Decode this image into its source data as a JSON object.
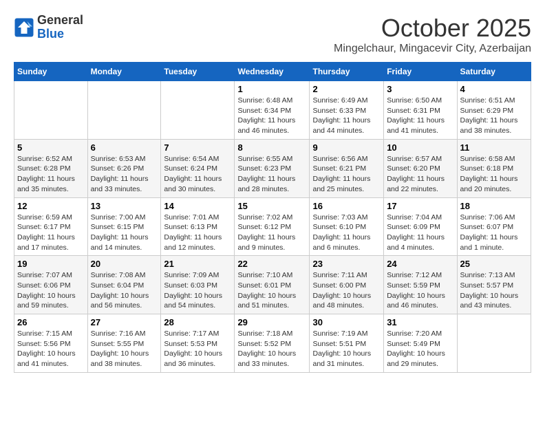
{
  "header": {
    "logo_line1": "General",
    "logo_line2": "Blue",
    "month": "October 2025",
    "location": "Mingelchaur, Mingacevir City, Azerbaijan"
  },
  "columns": [
    "Sunday",
    "Monday",
    "Tuesday",
    "Wednesday",
    "Thursday",
    "Friday",
    "Saturday"
  ],
  "weeks": [
    [
      {
        "day": "",
        "info": ""
      },
      {
        "day": "",
        "info": ""
      },
      {
        "day": "",
        "info": ""
      },
      {
        "day": "1",
        "info": "Sunrise: 6:48 AM\nSunset: 6:34 PM\nDaylight: 11 hours\nand 46 minutes."
      },
      {
        "day": "2",
        "info": "Sunrise: 6:49 AM\nSunset: 6:33 PM\nDaylight: 11 hours\nand 44 minutes."
      },
      {
        "day": "3",
        "info": "Sunrise: 6:50 AM\nSunset: 6:31 PM\nDaylight: 11 hours\nand 41 minutes."
      },
      {
        "day": "4",
        "info": "Sunrise: 6:51 AM\nSunset: 6:29 PM\nDaylight: 11 hours\nand 38 minutes."
      }
    ],
    [
      {
        "day": "5",
        "info": "Sunrise: 6:52 AM\nSunset: 6:28 PM\nDaylight: 11 hours\nand 35 minutes."
      },
      {
        "day": "6",
        "info": "Sunrise: 6:53 AM\nSunset: 6:26 PM\nDaylight: 11 hours\nand 33 minutes."
      },
      {
        "day": "7",
        "info": "Sunrise: 6:54 AM\nSunset: 6:24 PM\nDaylight: 11 hours\nand 30 minutes."
      },
      {
        "day": "8",
        "info": "Sunrise: 6:55 AM\nSunset: 6:23 PM\nDaylight: 11 hours\nand 28 minutes."
      },
      {
        "day": "9",
        "info": "Sunrise: 6:56 AM\nSunset: 6:21 PM\nDaylight: 11 hours\nand 25 minutes."
      },
      {
        "day": "10",
        "info": "Sunrise: 6:57 AM\nSunset: 6:20 PM\nDaylight: 11 hours\nand 22 minutes."
      },
      {
        "day": "11",
        "info": "Sunrise: 6:58 AM\nSunset: 6:18 PM\nDaylight: 11 hours\nand 20 minutes."
      }
    ],
    [
      {
        "day": "12",
        "info": "Sunrise: 6:59 AM\nSunset: 6:17 PM\nDaylight: 11 hours\nand 17 minutes."
      },
      {
        "day": "13",
        "info": "Sunrise: 7:00 AM\nSunset: 6:15 PM\nDaylight: 11 hours\nand 14 minutes."
      },
      {
        "day": "14",
        "info": "Sunrise: 7:01 AM\nSunset: 6:13 PM\nDaylight: 11 hours\nand 12 minutes."
      },
      {
        "day": "15",
        "info": "Sunrise: 7:02 AM\nSunset: 6:12 PM\nDaylight: 11 hours\nand 9 minutes."
      },
      {
        "day": "16",
        "info": "Sunrise: 7:03 AM\nSunset: 6:10 PM\nDaylight: 11 hours\nand 6 minutes."
      },
      {
        "day": "17",
        "info": "Sunrise: 7:04 AM\nSunset: 6:09 PM\nDaylight: 11 hours\nand 4 minutes."
      },
      {
        "day": "18",
        "info": "Sunrise: 7:06 AM\nSunset: 6:07 PM\nDaylight: 11 hours\nand 1 minute."
      }
    ],
    [
      {
        "day": "19",
        "info": "Sunrise: 7:07 AM\nSunset: 6:06 PM\nDaylight: 10 hours\nand 59 minutes."
      },
      {
        "day": "20",
        "info": "Sunrise: 7:08 AM\nSunset: 6:04 PM\nDaylight: 10 hours\nand 56 minutes."
      },
      {
        "day": "21",
        "info": "Sunrise: 7:09 AM\nSunset: 6:03 PM\nDaylight: 10 hours\nand 54 minutes."
      },
      {
        "day": "22",
        "info": "Sunrise: 7:10 AM\nSunset: 6:01 PM\nDaylight: 10 hours\nand 51 minutes."
      },
      {
        "day": "23",
        "info": "Sunrise: 7:11 AM\nSunset: 6:00 PM\nDaylight: 10 hours\nand 48 minutes."
      },
      {
        "day": "24",
        "info": "Sunrise: 7:12 AM\nSunset: 5:59 PM\nDaylight: 10 hours\nand 46 minutes."
      },
      {
        "day": "25",
        "info": "Sunrise: 7:13 AM\nSunset: 5:57 PM\nDaylight: 10 hours\nand 43 minutes."
      }
    ],
    [
      {
        "day": "26",
        "info": "Sunrise: 7:15 AM\nSunset: 5:56 PM\nDaylight: 10 hours\nand 41 minutes."
      },
      {
        "day": "27",
        "info": "Sunrise: 7:16 AM\nSunset: 5:55 PM\nDaylight: 10 hours\nand 38 minutes."
      },
      {
        "day": "28",
        "info": "Sunrise: 7:17 AM\nSunset: 5:53 PM\nDaylight: 10 hours\nand 36 minutes."
      },
      {
        "day": "29",
        "info": "Sunrise: 7:18 AM\nSunset: 5:52 PM\nDaylight: 10 hours\nand 33 minutes."
      },
      {
        "day": "30",
        "info": "Sunrise: 7:19 AM\nSunset: 5:51 PM\nDaylight: 10 hours\nand 31 minutes."
      },
      {
        "day": "31",
        "info": "Sunrise: 7:20 AM\nSunset: 5:49 PM\nDaylight: 10 hours\nand 29 minutes."
      },
      {
        "day": "",
        "info": ""
      }
    ]
  ]
}
